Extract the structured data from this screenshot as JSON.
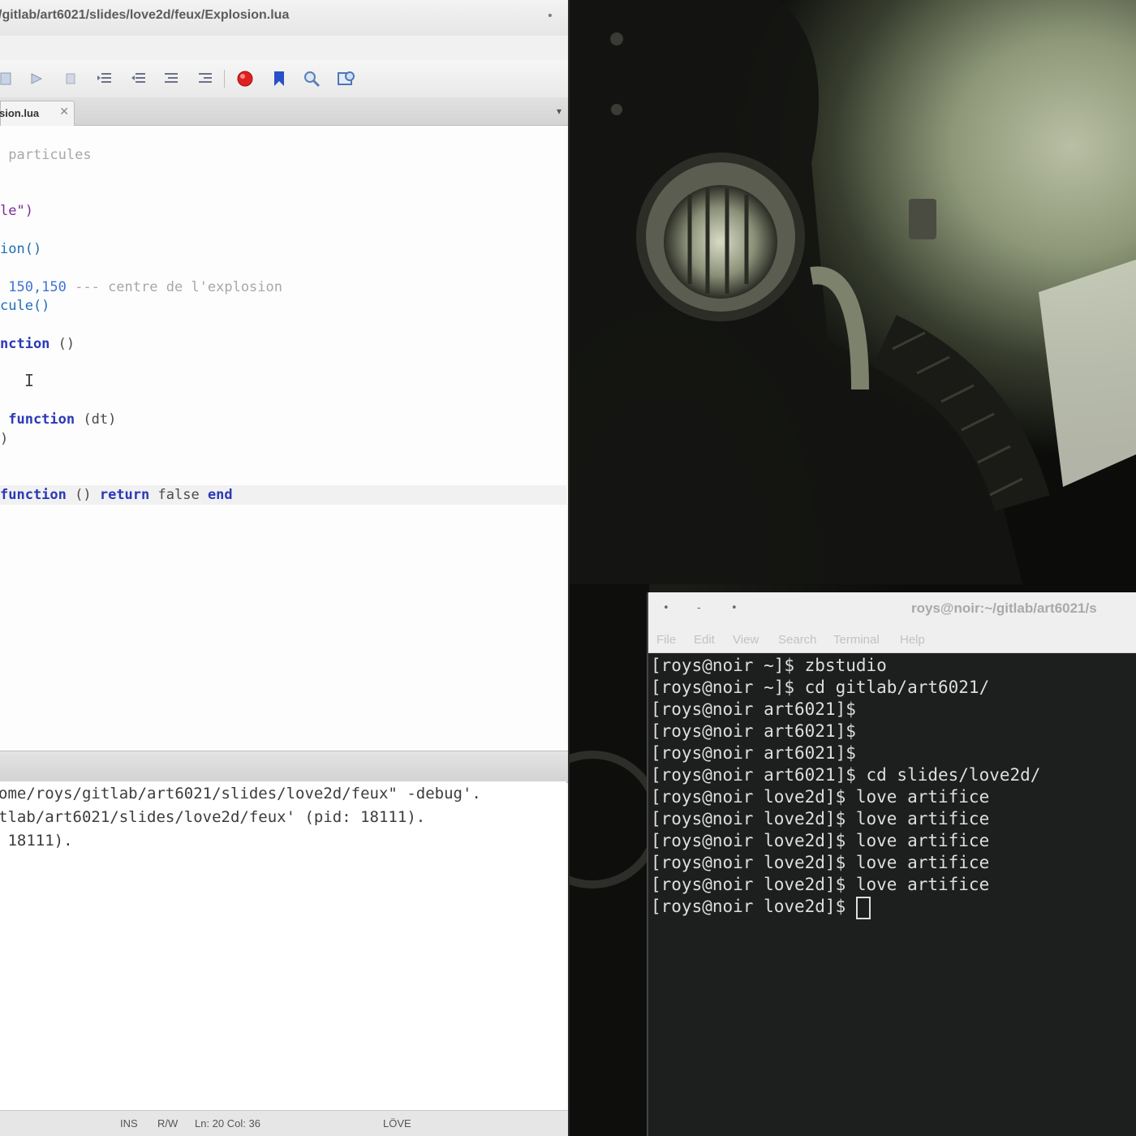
{
  "ide": {
    "title": "/gitlab/art6021/slides/love2d/feux/Explosion.lua",
    "close_glyph": "•",
    "tab_label": "sion.lua",
    "tab_close": "✕",
    "tab_dropdown": "▾",
    "editor_lines": [
      [
        {
          "t": " particules",
          "c": "cmt"
        }
      ],
      [
        {
          "t": "le\")",
          "c": "str"
        }
      ],
      [
        {
          "t": "ion()",
          "c": "fn"
        }
      ],
      [
        {
          "t": " 150,150",
          "c": "num"
        },
        {
          "t": " --- centre de l'explosion",
          "c": "cmt"
        }
      ],
      [
        {
          "t": "cule()",
          "c": "fn"
        }
      ],
      [
        {
          "t": "nction",
          "c": "kw"
        },
        {
          "t": " ()",
          "c": "plain"
        }
      ],
      [
        {
          "t": " function",
          "c": "kw"
        },
        {
          "t": " (dt)",
          "c": "plain"
        }
      ],
      [
        {
          "t": ")",
          "c": "plain"
        }
      ],
      [
        {
          "t": "function",
          "c": "kw"
        },
        {
          "t": " () ",
          "c": "plain"
        },
        {
          "t": "return",
          "c": "kw"
        },
        {
          "t": " f",
          "c": "plain"
        },
        {
          "t": "alse",
          "c": "plain"
        },
        {
          "t": " end",
          "c": "kw"
        }
      ]
    ],
    "output_lines": [
      "ome/roys/gitlab/art6021/slides/love2d/feux\" -debug'.",
      "tlab/art6021/slides/love2d/feux' (pid: 18111).",
      " 18111)."
    ],
    "status": {
      "ins": "INS",
      "rw": "R/W",
      "position": "Ln: 20 Col: 36",
      "interpreter": "LÖVE"
    }
  },
  "terminal": {
    "title": "roys@noir:~/gitlab/art6021/s",
    "window_buttons": [
      "•",
      "-",
      "•"
    ],
    "menu": [
      "File",
      "Edit",
      "View",
      "Search",
      "Terminal",
      "Help"
    ],
    "lines": [
      "[roys@noir ~]$ zbstudio",
      "[roys@noir ~]$ cd gitlab/art6021/",
      "[roys@noir art6021]$",
      "[roys@noir art6021]$",
      "[roys@noir art6021]$",
      "[roys@noir art6021]$ cd slides/love2d/",
      "[roys@noir love2d]$ love artifice",
      "[roys@noir love2d]$ love artifice",
      "[roys@noir love2d]$ love artifice",
      "[roys@noir love2d]$ love artifice",
      "[roys@noir love2d]$ love artifice",
      "[roys@noir love2d]$ "
    ]
  },
  "colors": {
    "keyword": "#2b39b8",
    "number": "#3c74d8",
    "comment": "#a8a8a8",
    "string": "#7d2b97",
    "breakpoint": "#e02020",
    "bookmark": "#2950c9"
  },
  "icons": [
    "step-over-icon",
    "step-into-icon",
    "pause-icon",
    "indent-icon",
    "outdent-icon",
    "comment-icon",
    "uncomment-icon",
    "breakpoint-icon",
    "bookmark-icon",
    "find-icon",
    "replace-icon"
  ]
}
